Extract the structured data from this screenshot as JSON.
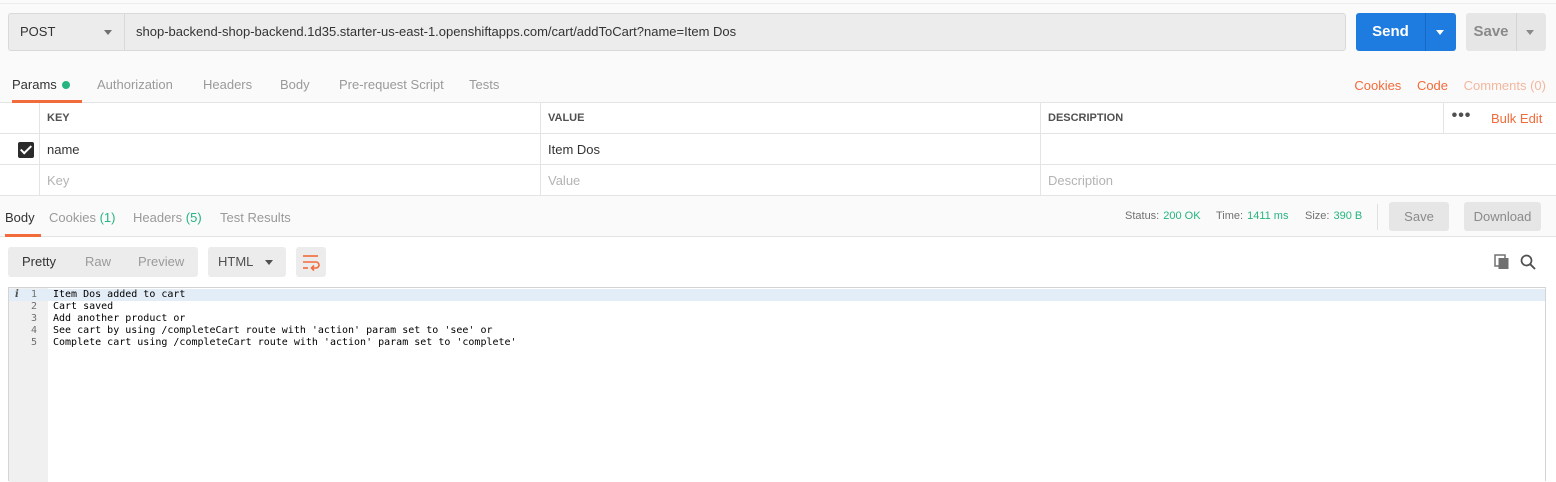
{
  "request": {
    "method": "POST",
    "url": "shop-backend-shop-backend.1d35.starter-us-east-1.openshiftapps.com/cart/addToCart?name=Item Dos",
    "send_label": "Send",
    "save_label": "Save"
  },
  "request_tabs": [
    {
      "label": "Params",
      "active": true,
      "indicator": "green-dot"
    },
    {
      "label": "Authorization"
    },
    {
      "label": "Headers"
    },
    {
      "label": "Body"
    },
    {
      "label": "Pre-request Script"
    },
    {
      "label": "Tests"
    }
  ],
  "request_links": {
    "cookies": "Cookies",
    "code": "Code",
    "comments": "Comments (0)"
  },
  "params": {
    "headers": {
      "key": "KEY",
      "value": "VALUE",
      "description": "DESCRIPTION"
    },
    "more_label": "•••",
    "bulk_edit": "Bulk Edit",
    "rows": [
      {
        "checked": true,
        "key": "name",
        "value": "Item Dos",
        "description": ""
      }
    ],
    "placeholders": {
      "key": "Key",
      "value": "Value",
      "description": "Description"
    }
  },
  "response": {
    "tabs": [
      {
        "label": "Body",
        "active": true
      },
      {
        "label": "Cookies",
        "count": "(1)"
      },
      {
        "label": "Headers",
        "count": "(5)"
      },
      {
        "label": "Test Results"
      }
    ],
    "status_label": "Status:",
    "status_value": "200 OK",
    "time_label": "Time:",
    "time_value": "1411 ms",
    "size_label": "Size:",
    "size_value": "390 B",
    "save_label": "Save",
    "download_label": "Download"
  },
  "viewer": {
    "modes": [
      "Pretty",
      "Raw",
      "Preview"
    ],
    "active_mode": "Pretty",
    "format": "HTML",
    "icons": [
      "wrap-lines-icon",
      "copy-icon",
      "search-icon"
    ],
    "info_marker": "i",
    "lines": [
      {
        "n": "1",
        "text": "Item Dos added to cart"
      },
      {
        "n": "2",
        "text": "Cart saved"
      },
      {
        "n": "3",
        "text": "Add another product or"
      },
      {
        "n": "4",
        "text": "See cart by using /completeCart route with 'action' param set to 'see' or"
      },
      {
        "n": "5",
        "text": "Complete cart using /completeCart route with 'action' param set to 'complete'"
      }
    ]
  },
  "colors": {
    "accent": "#f26b3a",
    "send": "#1e7be0",
    "success": "#26b47f"
  }
}
